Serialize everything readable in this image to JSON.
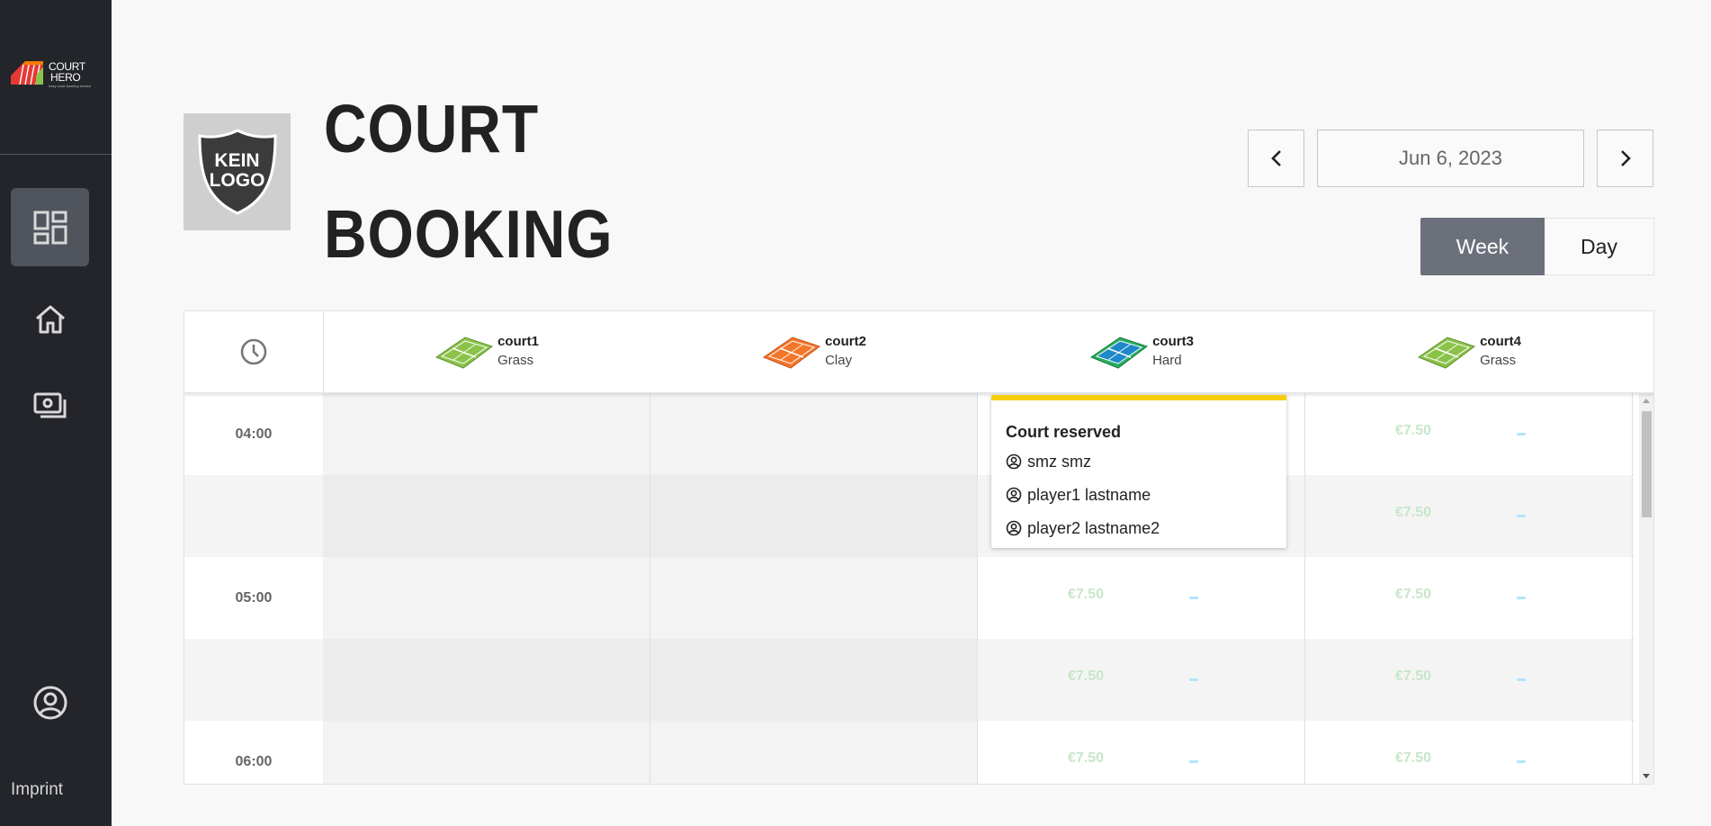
{
  "brand": {
    "name_line1": "COURT",
    "name_line2": "HERO",
    "tagline": "easy court booking service"
  },
  "sidebar": {
    "items": [
      {
        "name": "dashboard",
        "icon": "dashboard-icon",
        "active": true
      },
      {
        "name": "home",
        "icon": "home-icon",
        "active": false
      },
      {
        "name": "payments",
        "icon": "payments-icon",
        "active": false
      }
    ],
    "account_icon": "account-circle-icon",
    "imprint_label": "Imprint"
  },
  "club_logo": {
    "line1": "KEIN",
    "line2": "LOGO"
  },
  "page": {
    "title_line1": "COURT",
    "title_line2": "BOOKING"
  },
  "date_nav": {
    "current_date": "Jun 6, 2023",
    "prev_icon": "chevron-left-icon",
    "next_icon": "chevron-right-icon"
  },
  "view_toggle": {
    "week_label": "Week",
    "day_label": "Day",
    "selected": "Week"
  },
  "table": {
    "time_header_icon": "clock-icon",
    "courts": [
      {
        "name": "court1",
        "surface": "Grass",
        "color": "#8bc34a"
      },
      {
        "name": "court2",
        "surface": "Clay",
        "color": "#f4762a"
      },
      {
        "name": "court3",
        "surface": "Hard",
        "color": "#1e88c8"
      },
      {
        "name": "court4",
        "surface": "Grass",
        "color": "#8bc34a"
      }
    ],
    "rows": [
      {
        "time": "04:00",
        "cells": [
          "",
          "",
          "",
          "€7.50"
        ]
      },
      {
        "time": "",
        "cells": [
          "",
          "",
          "",
          "€7.50"
        ]
      },
      {
        "time": "05:00",
        "cells": [
          "",
          "",
          "€7.50",
          "€7.50"
        ]
      },
      {
        "time": "",
        "cells": [
          "",
          "",
          "€7.50",
          "€7.50"
        ]
      },
      {
        "time": "06:00",
        "cells": [
          "",
          "",
          "€7.50",
          "€7.50"
        ]
      }
    ]
  },
  "reservation_popup": {
    "title": "Court reserved",
    "players": [
      "smz smz",
      "player1 lastname",
      "player2 lastname2"
    ],
    "accent_color": "#f7cc0d"
  },
  "colors": {
    "sidebar_bg": "#23252a",
    "price_text": "#c8e6c9",
    "dash": "#b3e5fc",
    "week_active_bg": "#6c707b"
  }
}
